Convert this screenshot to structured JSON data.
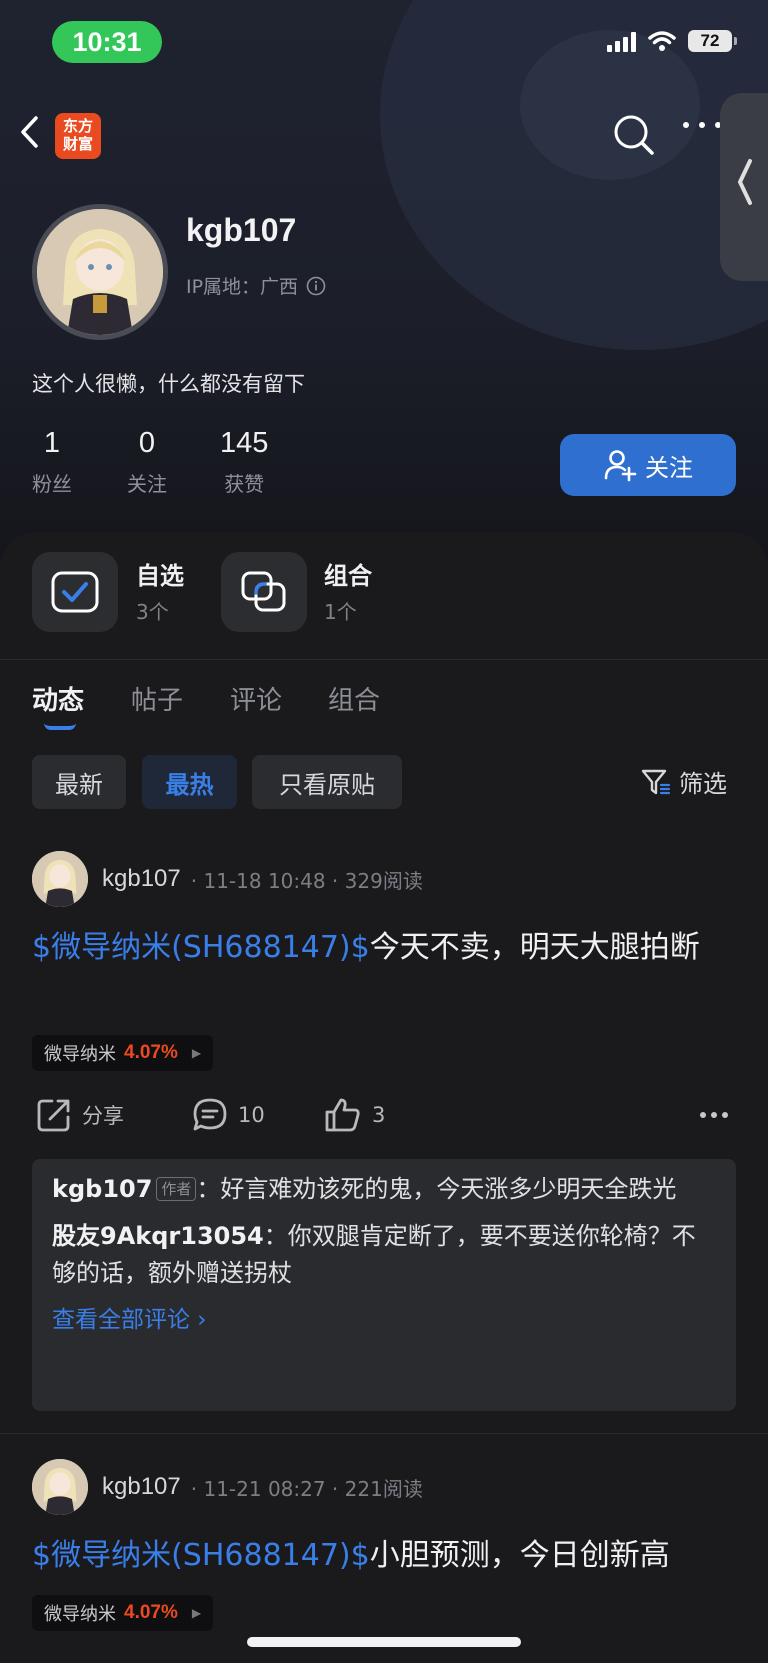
{
  "status": {
    "time": "10:31",
    "battery": "72"
  },
  "nav": {
    "logo_text": "东方财富"
  },
  "profile": {
    "username": "kgb107",
    "ip_label": "IP属地：广西",
    "bio": "这个人很懒，什么都没有留下",
    "stats": [
      {
        "num": "1",
        "label": "粉丝"
      },
      {
        "num": "0",
        "label": "关注"
      },
      {
        "num": "145",
        "label": "获赞"
      }
    ],
    "follow_label": "关注"
  },
  "tiles": [
    {
      "title": "自选",
      "sub": "3个",
      "icon": "watchlist-check-icon"
    },
    {
      "title": "组合",
      "sub": "1个",
      "icon": "portfolio-icon"
    }
  ],
  "tabs": [
    "动态",
    "帖子",
    "评论",
    "组合"
  ],
  "chips": [
    "最新",
    "最热",
    "只看原贴"
  ],
  "filter_label": "筛选",
  "posts": [
    {
      "user": "kgb107",
      "meta": "· 11-18 10:48 · 329阅读",
      "stock": "$微导纳米(SH688147)$",
      "text": "今天不卖，明天大腿拍断",
      "tag_name": "微导纳米",
      "tag_pct": "4.07%",
      "share": "分享",
      "comments_count": "10",
      "likes": "3"
    },
    {
      "user": "kgb107",
      "meta": "· 11-21 08:27 · 221阅读",
      "stock": "$微导纳米(SH688147)$",
      "text": "小胆预测，今日创新高",
      "tag_name": "微导纳米",
      "tag_pct": "4.07%"
    }
  ],
  "comments": [
    {
      "name": "kgb107",
      "badge": "作者",
      "text": "：好言难劝该死的鬼，今天涨多少明天全跌光"
    },
    {
      "name": "股友9Akqr13054",
      "text": "：你双腿肯定断了，要不要送你轮椅？不够的话，额外赠送拐杖"
    }
  ],
  "see_all": "查看全部评论 ›"
}
